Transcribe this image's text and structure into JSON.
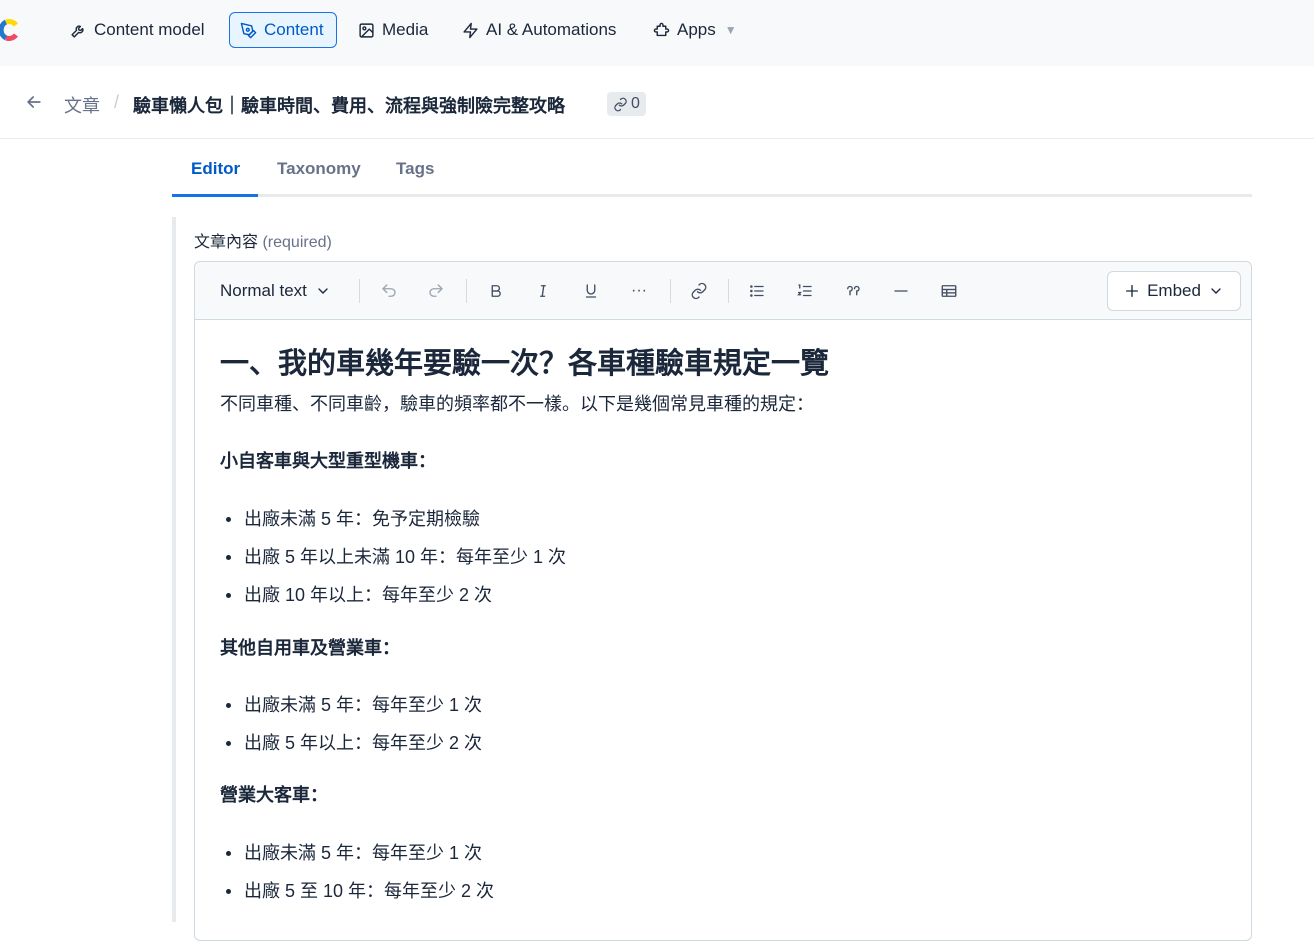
{
  "nav": {
    "content_model": "Content model",
    "content": "Content",
    "media": "Media",
    "ai_automations": "AI & Automations",
    "apps": "Apps"
  },
  "breadcrumb": {
    "parent": "文章",
    "separator": "/",
    "title": "驗車懶人包｜驗車時間、費用、流程與強制險完整攻略",
    "references_count": "0"
  },
  "tabs": [
    "Editor",
    "Taxonomy",
    "Tags"
  ],
  "field": {
    "label": "文章內容",
    "required": "(required)"
  },
  "toolbar": {
    "text_format": "Normal text",
    "more": "···",
    "embed": "Embed"
  },
  "article": {
    "heading": "一、我的車幾年要驗一次？各車種驗車規定一覽",
    "intro": "不同車種、不同車齡，驗車的頻率都不一樣。以下是幾個常見車種的規定：",
    "sections": [
      {
        "title": "小自客車與大型重型機車：",
        "items": [
          "出廠未滿 5 年：免予定期檢驗",
          "出廠 5 年以上未滿 10 年：每年至少 1 次",
          "出廠 10 年以上：每年至少 2 次"
        ]
      },
      {
        "title": "其他自用車及營業車：",
        "items": [
          "出廠未滿 5 年：每年至少 1 次",
          "出廠 5 年以上：每年至少 2 次"
        ]
      },
      {
        "title": "營業大客車：",
        "items": [
          "出廠未滿 5 年：每年至少 1 次",
          "出廠 5 至 10 年：每年至少 2 次"
        ]
      }
    ]
  },
  "colors": {
    "accent": "#1872e6",
    "active_text": "#0059c8",
    "nav_bg": "#f7f9fa",
    "text": "#1b273a",
    "muted": "#67728a"
  }
}
